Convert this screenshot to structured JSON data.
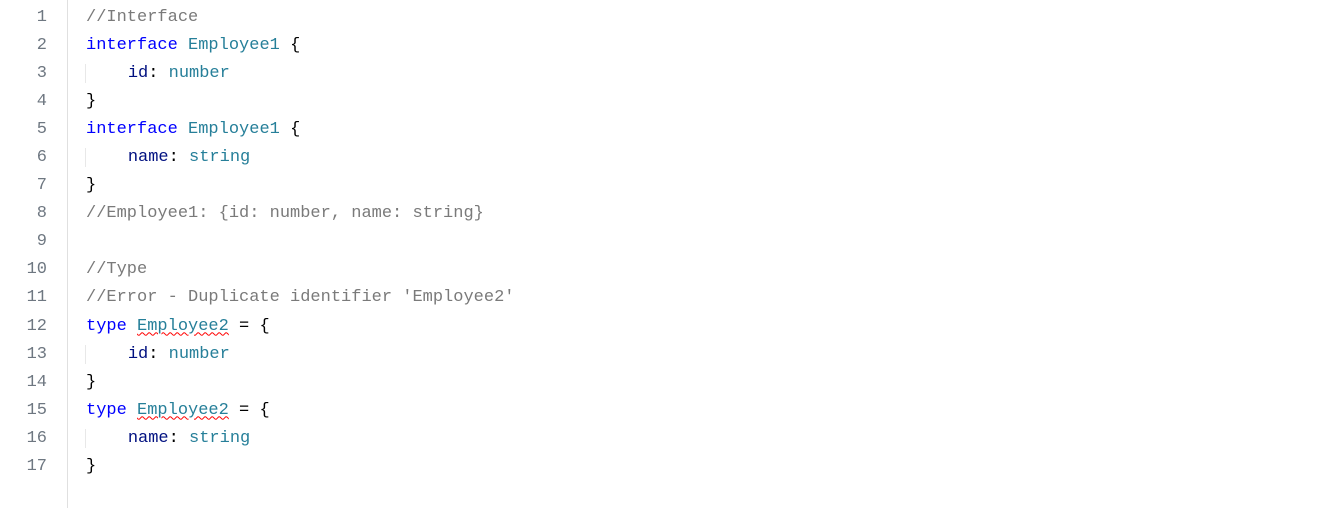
{
  "editor": {
    "lines": [
      {
        "num": "1",
        "tokens": [
          {
            "cls": "tok-comment",
            "text": "//Interface"
          }
        ]
      },
      {
        "num": "2",
        "tokens": [
          {
            "cls": "tok-keyword",
            "text": "interface"
          },
          {
            "cls": "",
            "text": " "
          },
          {
            "cls": "tok-type",
            "text": "Employee1"
          },
          {
            "cls": "",
            "text": " "
          },
          {
            "cls": "tok-punct",
            "text": "{"
          }
        ]
      },
      {
        "num": "3",
        "indent": 1,
        "tokens": [
          {
            "cls": "tok-prop",
            "text": "id"
          },
          {
            "cls": "tok-punct",
            "text": ":"
          },
          {
            "cls": "",
            "text": " "
          },
          {
            "cls": "tok-type",
            "text": "number"
          }
        ]
      },
      {
        "num": "4",
        "tokens": [
          {
            "cls": "tok-punct",
            "text": "}"
          }
        ]
      },
      {
        "num": "5",
        "tokens": [
          {
            "cls": "tok-keyword",
            "text": "interface"
          },
          {
            "cls": "",
            "text": " "
          },
          {
            "cls": "tok-type",
            "text": "Employee1"
          },
          {
            "cls": "",
            "text": " "
          },
          {
            "cls": "tok-punct",
            "text": "{"
          }
        ]
      },
      {
        "num": "6",
        "indent": 1,
        "tokens": [
          {
            "cls": "tok-prop",
            "text": "name"
          },
          {
            "cls": "tok-punct",
            "text": ":"
          },
          {
            "cls": "",
            "text": " "
          },
          {
            "cls": "tok-type",
            "text": "string"
          }
        ]
      },
      {
        "num": "7",
        "tokens": [
          {
            "cls": "tok-punct",
            "text": "}"
          }
        ]
      },
      {
        "num": "8",
        "tokens": [
          {
            "cls": "tok-comment",
            "text": "//Employee1: {id: number, name: string}"
          }
        ]
      },
      {
        "num": "9",
        "tokens": []
      },
      {
        "num": "10",
        "tokens": [
          {
            "cls": "tok-comment",
            "text": "//Type"
          }
        ]
      },
      {
        "num": "11",
        "tokens": [
          {
            "cls": "tok-comment",
            "text": "//Error - Duplicate identifier 'Employee2'"
          }
        ]
      },
      {
        "num": "12",
        "tokens": [
          {
            "cls": "tok-keyword",
            "text": "type"
          },
          {
            "cls": "",
            "text": " "
          },
          {
            "cls": "tok-type squiggle",
            "text": "Employee2"
          },
          {
            "cls": "",
            "text": " "
          },
          {
            "cls": "tok-punct",
            "text": "="
          },
          {
            "cls": "",
            "text": " "
          },
          {
            "cls": "tok-punct",
            "text": "{"
          }
        ]
      },
      {
        "num": "13",
        "indent": 1,
        "tokens": [
          {
            "cls": "tok-prop",
            "text": "id"
          },
          {
            "cls": "tok-punct",
            "text": ":"
          },
          {
            "cls": "",
            "text": " "
          },
          {
            "cls": "tok-type",
            "text": "number"
          }
        ]
      },
      {
        "num": "14",
        "tokens": [
          {
            "cls": "tok-punct",
            "text": "}"
          }
        ]
      },
      {
        "num": "15",
        "tokens": [
          {
            "cls": "tok-keyword",
            "text": "type"
          },
          {
            "cls": "",
            "text": " "
          },
          {
            "cls": "tok-type squiggle",
            "text": "Employee2"
          },
          {
            "cls": "",
            "text": " "
          },
          {
            "cls": "tok-punct",
            "text": "="
          },
          {
            "cls": "",
            "text": " "
          },
          {
            "cls": "tok-punct",
            "text": "{"
          }
        ]
      },
      {
        "num": "16",
        "indent": 1,
        "tokens": [
          {
            "cls": "tok-prop",
            "text": "name"
          },
          {
            "cls": "tok-punct",
            "text": ":"
          },
          {
            "cls": "",
            "text": " "
          },
          {
            "cls": "tok-type",
            "text": "string"
          }
        ]
      },
      {
        "num": "17",
        "tokens": [
          {
            "cls": "tok-punct",
            "text": "}"
          }
        ]
      }
    ]
  }
}
